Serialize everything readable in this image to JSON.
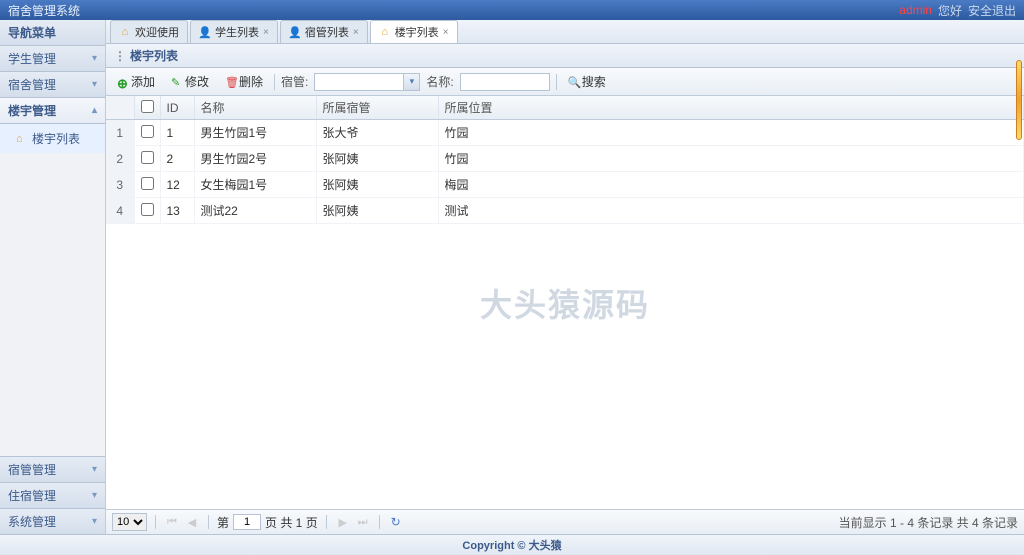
{
  "header": {
    "title": "宿舍管理系统",
    "admin": "admin",
    "hello": "您好",
    "logout": "安全退出"
  },
  "sidebar": {
    "title": "导航菜单",
    "top": [
      {
        "label": "学生管理"
      },
      {
        "label": "宿舍管理"
      },
      {
        "label": "楼宇管理",
        "active": true
      }
    ],
    "sub": "楼宇列表",
    "bottom": [
      {
        "label": "宿管管理"
      },
      {
        "label": "住宿管理"
      },
      {
        "label": "系统管理"
      }
    ]
  },
  "tabs": [
    {
      "label": "欢迎使用",
      "icon": "home",
      "closable": false
    },
    {
      "label": "学生列表",
      "icon": "user-b",
      "closable": true
    },
    {
      "label": "宿管列表",
      "icon": "user-r",
      "closable": true
    },
    {
      "label": "楼宇列表",
      "icon": "building",
      "closable": true,
      "active": true
    }
  ],
  "panel": {
    "title": "楼宇列表"
  },
  "toolbar": {
    "add": "添加",
    "edit": "修改",
    "del": "删除",
    "f1label": "宿管:",
    "f1placeholder": "",
    "f2label": "名称:",
    "f2placeholder": "",
    "search": "搜索"
  },
  "columns": {
    "id": "ID",
    "name": "名称",
    "owner": "所属宿管",
    "loc": "所属位置"
  },
  "rows": [
    {
      "id": "1",
      "name": "男生竹园1号",
      "owner": "张大爷",
      "loc": "竹园"
    },
    {
      "id": "2",
      "name": "男生竹园2号",
      "owner": "张阿姨",
      "loc": "竹园"
    },
    {
      "id": "12",
      "name": "女生梅园1号",
      "owner": "张阿姨",
      "loc": "梅园"
    },
    {
      "id": "13",
      "name": "测试22",
      "owner": "张阿姨",
      "loc": "测试"
    }
  ],
  "pager": {
    "size": "10",
    "pagePrefix": "第",
    "pageNum": "1",
    "pageSuffix": "页 共 1 页",
    "info": "当前显示 1 - 4 条记录 共 4 条记录"
  },
  "footer": "Copyright © 大头猿",
  "watermark": "大头猿源码"
}
